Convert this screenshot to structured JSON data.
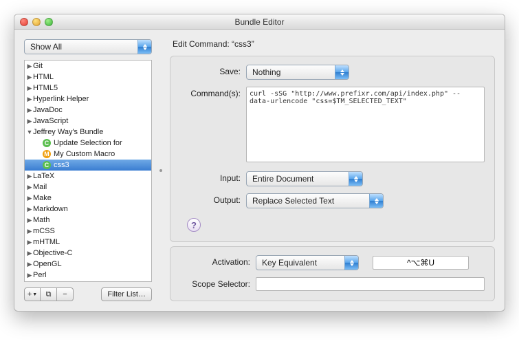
{
  "window": {
    "title": "Bundle Editor"
  },
  "filter": {
    "selected": "Show All"
  },
  "tree": {
    "items": [
      {
        "label": "Git",
        "expanded": false,
        "depth": 0
      },
      {
        "label": "HTML",
        "expanded": false,
        "depth": 0
      },
      {
        "label": "HTML5",
        "expanded": false,
        "depth": 0
      },
      {
        "label": "Hyperlink Helper",
        "expanded": false,
        "depth": 0
      },
      {
        "label": "JavaDoc",
        "expanded": false,
        "depth": 0
      },
      {
        "label": "JavaScript",
        "expanded": false,
        "depth": 0
      },
      {
        "label": "Jeffrey Way's Bundle",
        "expanded": true,
        "depth": 0
      },
      {
        "label": "Update Selection for ",
        "leaf": true,
        "icon": "c",
        "depth": 1
      },
      {
        "label": "My Custom Macro",
        "leaf": true,
        "icon": "m",
        "depth": 1
      },
      {
        "label": "css3",
        "leaf": true,
        "icon": "c",
        "depth": 1,
        "selected": true
      },
      {
        "label": "LaTeX",
        "expanded": false,
        "depth": 0
      },
      {
        "label": "Mail",
        "expanded": false,
        "depth": 0
      },
      {
        "label": "Make",
        "expanded": false,
        "depth": 0
      },
      {
        "label": "Markdown",
        "expanded": false,
        "depth": 0
      },
      {
        "label": "Math",
        "expanded": false,
        "depth": 0
      },
      {
        "label": "mCSS",
        "expanded": false,
        "depth": 0
      },
      {
        "label": "mHTML",
        "expanded": false,
        "depth": 0
      },
      {
        "label": "Objective-C",
        "expanded": false,
        "depth": 0
      },
      {
        "label": "OpenGL",
        "expanded": false,
        "depth": 0
      },
      {
        "label": "Perl",
        "expanded": false,
        "depth": 0
      }
    ]
  },
  "footer": {
    "add_menu": "+",
    "duplicate": "⧉",
    "remove": "−",
    "filter_button": "Filter List…"
  },
  "editor": {
    "heading_prefix": "Edit Command: ",
    "heading_name": "“css3”",
    "labels": {
      "save": "Save:",
      "commands": "Command(s):",
      "input": "Input:",
      "output": "Output:",
      "activation": "Activation:",
      "scope": "Scope Selector:"
    },
    "save_value": "Nothing",
    "commands_value": "curl -sSG \"http://www.prefixr.com/api/index.php\" --data-urlencode \"css=$TM_SELECTED_TEXT\"",
    "input_value": "Entire Document",
    "output_value": "Replace Selected Text",
    "activation_type": "Key Equivalent",
    "activation_value": "^⌥⌘U",
    "scope_value": ""
  },
  "icons": {
    "help": "?"
  }
}
